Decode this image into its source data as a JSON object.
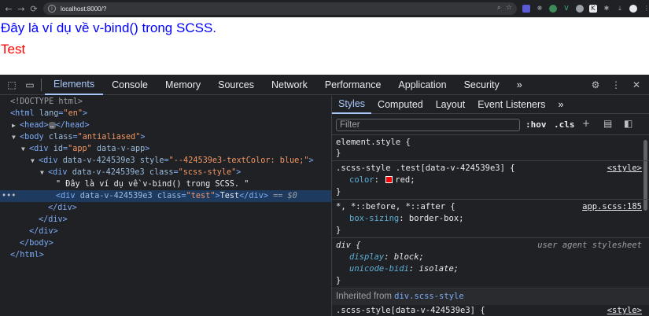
{
  "browser": {
    "url": "localhost:8000/?",
    "nav": {
      "back": "←",
      "forward": "→",
      "reload": "⟳"
    }
  },
  "page": {
    "line1": "Đây là ví dụ về v-bind() trong SCSS.",
    "line2": "Test"
  },
  "devtools": {
    "tabs": [
      "Elements",
      "Console",
      "Memory",
      "Sources",
      "Network",
      "Performance",
      "Application",
      "Security"
    ],
    "active_tab": "Elements",
    "more_tabs": "»",
    "elements": {
      "doctype": "<!DOCTYPE html>",
      "html_lang_attr": "lang",
      "html_lang_val": "\"en\"",
      "head_ellipsis": "…",
      "body_class_attr": "class",
      "body_class_val": "\"antialiased\"",
      "app_id_attr": "id",
      "app_id_val": "\"app\"",
      "app_extra_attr": "data-v-app",
      "div_scope_attr": "data-v-424539e3",
      "div_style_attr": "style",
      "div_style_val": "\"--424539e3-textColor: blue;\"",
      "scss_class_attr": "class",
      "scss_class_val": "\"scss-style\"",
      "text_node": "\" Đây là ví dụ về v-bind() trong SCSS. \"",
      "test_class_val": "\"test\"",
      "test_text": "Test",
      "selected_ref": "== $0",
      "row_dots": "•••"
    },
    "styles_tabs": [
      "Styles",
      "Computed",
      "Layout",
      "Event Listeners"
    ],
    "filter_placeholder": "Filter",
    "filter_buttons": {
      "hov": ":hov",
      "cls": ".cls"
    },
    "rules": {
      "element_style": "element.style {",
      "close_brace": "}",
      "r1_selector": ".scss-style .test[data-v-424539e3] {",
      "r1_source": "<style>",
      "r1_prop": "color",
      "r1_val": "red;",
      "r2_selector": "*, *::before, *::after {",
      "r2_source": "app.scss:185",
      "r2_prop": "box-sizing",
      "r2_val": "border-box;",
      "r3_selector": "div {",
      "r3_source": "user agent stylesheet",
      "r3_prop1": "display",
      "r3_val1": "block;",
      "r3_prop2": "unicode-bidi",
      "r3_val2": "isolate;",
      "inherited_label": "Inherited from",
      "inherited_from": "div.scss-style",
      "r4_selector": ".scss-style[data-v-424539e3] {",
      "r4_source": "<style>"
    }
  }
}
